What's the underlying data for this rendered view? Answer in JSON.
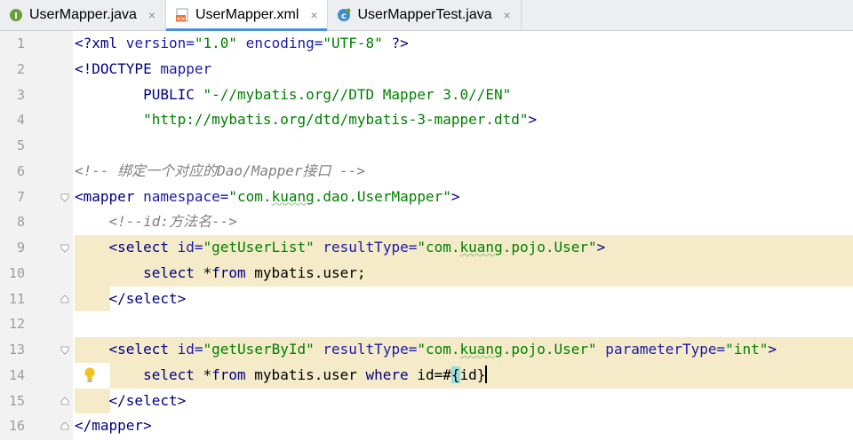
{
  "tabs": [
    {
      "label": "UserMapper.java",
      "icon": "interface-icon",
      "icon_letter": "I",
      "icon_color": "#6a9f3a",
      "active": false
    },
    {
      "label": "UserMapper.xml",
      "icon": "xml-file-icon",
      "icon_letter": "<>",
      "icon_color": "#e8743b",
      "active": true
    },
    {
      "label": "UserMapperTest.java",
      "icon": "class-icon",
      "icon_letter": "c",
      "icon_color": "#3b8fcf",
      "active": false
    }
  ],
  "close_glyph": "×",
  "line_numbers": [
    "1",
    "2",
    "3",
    "4",
    "5",
    "6",
    "7",
    "8",
    "9",
    "10",
    "11",
    "12",
    "13",
    "14",
    "15",
    "16"
  ],
  "code": {
    "l1": {
      "open": "<?",
      "name": "xml",
      "a1": " version",
      "eq1": "=",
      "v1": "\"1.0\"",
      "a2": " encoding",
      "eq2": "=",
      "v2": "\"UTF-8\"",
      "close": " ?>"
    },
    "l2": {
      "doctype": "<!DOCTYPE",
      "root": " mapper"
    },
    "l3": {
      "indent": "        ",
      "public": "PUBLIC",
      "sp": " ",
      "fpi": "\"-//mybatis.org//DTD Mapper 3.0//EN\""
    },
    "l4": {
      "indent": "        ",
      "dtd": "\"http://mybatis.org/dtd/mybatis-3-mapper.dtd\"",
      "gt": ">"
    },
    "l6": {
      "comment": "<!-- 绑定一个对应的Dao/Mapper接口 -->"
    },
    "l7": {
      "lt": "<mapper",
      "attr": " namespace",
      "eq": "=",
      "q1": "\"com.",
      "sq": "kuang",
      "q2": ".dao.UserMapper\"",
      "gt": ">"
    },
    "l8": {
      "indent": "    ",
      "comment": "<!--id:方法名-->"
    },
    "l9": {
      "indent": "    ",
      "lt": "<select",
      "a1": " id",
      "eq1": "=",
      "v1": "\"getUserList\"",
      "a2": " resultType",
      "eq2": "=",
      "v2a": "\"com.",
      "sq": "kuang",
      "v2b": ".pojo.User\"",
      "gt": ">"
    },
    "l10": {
      "indent": "        ",
      "kw1": "select",
      "rest1": " *",
      "kw2": "from",
      "rest2": " mybatis.user;"
    },
    "l11": {
      "indent": "    ",
      "tag": "</select>"
    },
    "l13": {
      "indent": "    ",
      "lt": "<select",
      "a1": " id",
      "eq1": "=",
      "v1": "\"getUserById\"",
      "a2": " resultType",
      "eq2": "=",
      "v2a": "\"com.",
      "sq": "kuang",
      "v2b": ".pojo.User\"",
      "a3": " parameterType",
      "eq3": "=",
      "v3": "\"int\"",
      "gt": ">"
    },
    "l14": {
      "indent": "        ",
      "kw1": "select",
      "rest1": " *",
      "kw2": "from",
      "rest2": " mybatis.user ",
      "kw3": "where",
      "rest3": " id=#",
      "brace_open": "{",
      "param": "id",
      "brace_close": "}"
    },
    "l15": {
      "indent": "    ",
      "tag": "</select>"
    },
    "l16": {
      "tag": "</mapper>"
    }
  },
  "colors": {
    "tag": "#000080",
    "attribute": "#1a1aa6",
    "value": "#008000",
    "comment": "#808080",
    "highlight": "#f5ebc9",
    "active_tab_underline": "#4a8fe7"
  }
}
